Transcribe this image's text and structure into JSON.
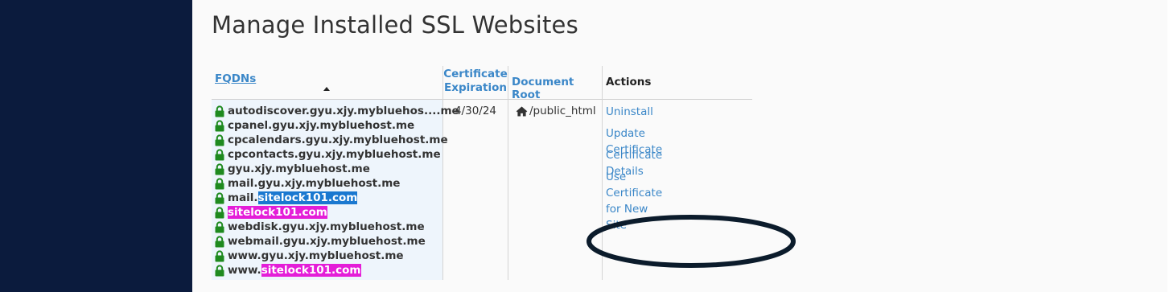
{
  "page": {
    "title": "Manage Installed SSL Websites"
  },
  "table": {
    "headers": {
      "fqdns": "FQDNs",
      "certificate_expiration": "Certificate Expiration",
      "document_root": "Document Root",
      "actions": "Actions"
    },
    "sort_indicator": "ascending",
    "row": {
      "fqdns": [
        {
          "prefix": "autodiscover.gyu.xjy.mybluehos....me",
          "highlight": "",
          "highlight_style": ""
        },
        {
          "prefix": "cpanel.gyu.xjy.mybluehost.me",
          "highlight": "",
          "highlight_style": ""
        },
        {
          "prefix": "cpcalendars.gyu.xjy.mybluehost.me",
          "highlight": "",
          "highlight_style": ""
        },
        {
          "prefix": "cpcontacts.gyu.xjy.mybluehost.me",
          "highlight": "",
          "highlight_style": ""
        },
        {
          "prefix": "gyu.xjy.mybluehost.me",
          "highlight": "",
          "highlight_style": ""
        },
        {
          "prefix": "mail.gyu.xjy.mybluehost.me",
          "highlight": "",
          "highlight_style": ""
        },
        {
          "prefix": "mail.",
          "highlight": "sitelock101.com",
          "highlight_style": "blue"
        },
        {
          "prefix": "",
          "highlight": "sitelock101.com",
          "highlight_style": "pink"
        },
        {
          "prefix": "webdisk.gyu.xjy.mybluehost.me",
          "highlight": "",
          "highlight_style": ""
        },
        {
          "prefix": "webmail.gyu.xjy.mybluehost.me",
          "highlight": "",
          "highlight_style": ""
        },
        {
          "prefix": "www.gyu.xjy.mybluehost.me",
          "highlight": "",
          "highlight_style": ""
        },
        {
          "prefix": "www.",
          "highlight": "sitelock101.com",
          "highlight_style": "pink"
        }
      ],
      "expiration": "4/30/24",
      "document_root": "/public_html",
      "actions": [
        "Uninstall",
        "Update Certificate",
        "Certificate Details",
        "Use Certificate for New Site"
      ]
    }
  },
  "icons": {
    "lock": "lock-icon",
    "home": "home-icon",
    "sort": "sort-ascending-icon"
  },
  "colors": {
    "sidebar": "#0b1b3d",
    "link": "#3b87c8",
    "lock": "#1f8a1f",
    "highlight_blue": "#1a78d0",
    "highlight_pink": "#e41ed8",
    "annotation": "#0b1b2b"
  }
}
